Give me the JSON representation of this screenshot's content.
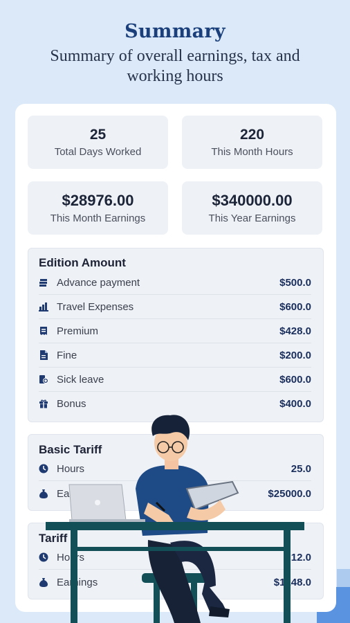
{
  "header": {
    "title": "Summary",
    "subtitle": "Summary of overall earnings, tax and working hours"
  },
  "stats": {
    "days_worked": {
      "value": "25",
      "label": "Total Days Worked"
    },
    "month_hours": {
      "value": "220",
      "label": "This Month Hours"
    },
    "month_earnings": {
      "value": "$28976.00",
      "label": "This Month Earnings"
    },
    "year_earnings": {
      "value": "$340000.00",
      "label": "This Year Earnings"
    }
  },
  "edition": {
    "title": "Edition Amount",
    "items": [
      {
        "label": "Advance payment",
        "amount": "$500.0",
        "icon": "money-stack-icon"
      },
      {
        "label": "Travel Expenses",
        "amount": "$600.0",
        "icon": "bar-chart-icon"
      },
      {
        "label": "Premium",
        "amount": "$428.0",
        "icon": "receipt-icon"
      },
      {
        "label": "Fine",
        "amount": "$200.0",
        "icon": "document-icon"
      },
      {
        "label": "Sick leave",
        "amount": "$600.0",
        "icon": "medical-icon"
      },
      {
        "label": "Bonus",
        "amount": "$400.0",
        "icon": "gift-icon"
      }
    ]
  },
  "basic_tariff": {
    "title": "Basic Tariff",
    "items": [
      {
        "label": "Hours",
        "amount": "25.0",
        "icon": "clock-icon"
      },
      {
        "label": "Earnings",
        "amount": "$25000.0",
        "icon": "money-bag-icon"
      }
    ]
  },
  "tariff": {
    "title": "Tariff",
    "items": [
      {
        "label": "Hours",
        "amount": "12.0",
        "icon": "clock-icon"
      },
      {
        "label": "Earnings",
        "amount": "$1248.0",
        "icon": "money-bag-icon"
      }
    ]
  },
  "colors": {
    "background": "#dbe9f8",
    "title": "#1a3f7a",
    "amount": "#1a2e5c",
    "icon": "#1f3a70"
  }
}
